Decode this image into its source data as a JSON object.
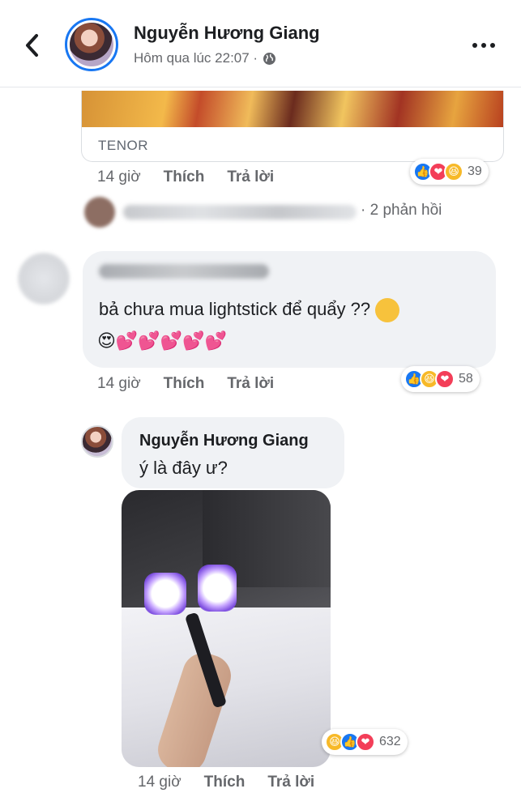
{
  "header": {
    "author_name": "Nguyễn Hương Giang",
    "timestamp": "Hôm qua lúc 22:07 ·",
    "privacy_icon": "globe-icon",
    "back_icon": "chevron-left-icon",
    "more_icon": "more-horizontal-icon"
  },
  "gif_comment": {
    "source_label": "TENOR",
    "time": "14 giờ",
    "like_label": "Thích",
    "reply_label": "Trả lời",
    "reactions": [
      "like",
      "love",
      "haha"
    ],
    "reaction_count": "39",
    "replies_summary": "· 2 phản hồi"
  },
  "comment": {
    "text": "bả chưa mua lightstick để quẩy  ??",
    "emoji_line": "😍💕💕💕💕💕",
    "time": "14 giờ",
    "like_label": "Thích",
    "reply_label": "Trả lời",
    "reactions": [
      "like",
      "haha",
      "love"
    ],
    "reaction_count": "58"
  },
  "reply": {
    "author_name": "Nguyễn Hương Giang",
    "text": "ý là đây ư?",
    "reactions": [
      "haha",
      "like",
      "love"
    ],
    "reaction_count": "632",
    "time": "14 giờ",
    "like_label": "Thích",
    "reply_label": "Trả lời"
  },
  "colors": {
    "accent": "#1877f2",
    "love": "#f33e58",
    "haha": "#f7b928",
    "bubble": "#f0f2f5",
    "meta_text": "#65676b"
  }
}
